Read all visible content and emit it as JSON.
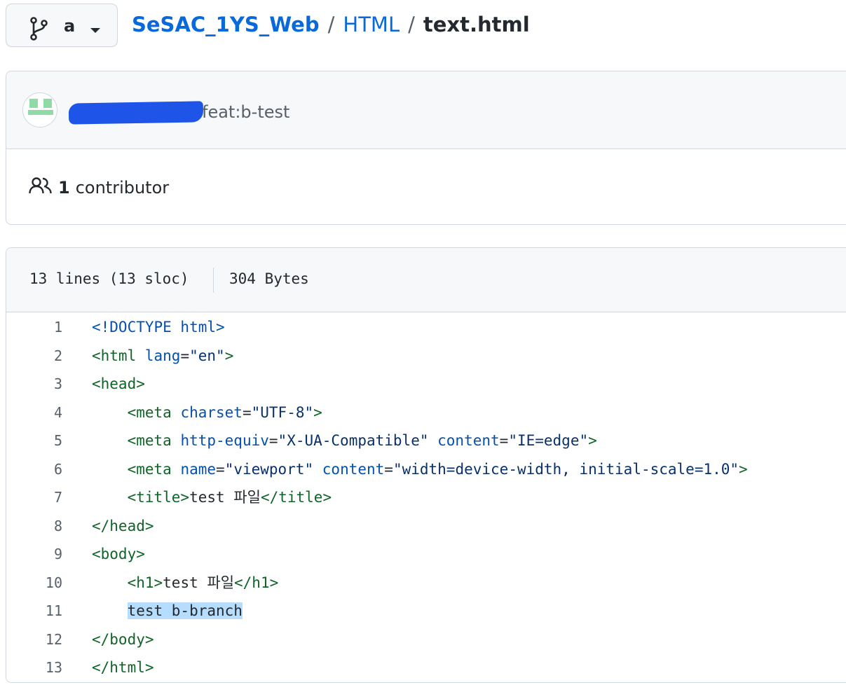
{
  "branch": {
    "name": "a"
  },
  "breadcrumb": {
    "repo": "SeSAC_1YS_Web",
    "dir": "HTML",
    "separator": "/",
    "file": "text.html"
  },
  "commit": {
    "message": "feat:b-test"
  },
  "contributors": {
    "count": "1",
    "label": "contributor"
  },
  "file_info": {
    "lines": "13 lines (13 sloc)",
    "size": "304 Bytes"
  },
  "code_lines": [
    {
      "num": "1",
      "indent": "",
      "tokens": [
        [
          "doc",
          "<!DOCTYPE html>"
        ]
      ]
    },
    {
      "num": "2",
      "indent": "",
      "tokens": [
        [
          "tag",
          "<html"
        ],
        [
          "text",
          " "
        ],
        [
          "attr",
          "lang"
        ],
        [
          "text",
          "="
        ],
        [
          "str",
          "\"en\""
        ],
        [
          "tag",
          ">"
        ]
      ]
    },
    {
      "num": "3",
      "indent": "",
      "tokens": [
        [
          "tag",
          "<head>"
        ]
      ]
    },
    {
      "num": "4",
      "indent": "    ",
      "tokens": [
        [
          "tag",
          "<meta"
        ],
        [
          "text",
          " "
        ],
        [
          "attr",
          "charset"
        ],
        [
          "text",
          "="
        ],
        [
          "str",
          "\"UTF-8\""
        ],
        [
          "tag",
          ">"
        ]
      ]
    },
    {
      "num": "5",
      "indent": "    ",
      "tokens": [
        [
          "tag",
          "<meta"
        ],
        [
          "text",
          " "
        ],
        [
          "attr",
          "http-equiv"
        ],
        [
          "text",
          "="
        ],
        [
          "str",
          "\"X-UA-Compatible\""
        ],
        [
          "text",
          " "
        ],
        [
          "attr",
          "content"
        ],
        [
          "text",
          "="
        ],
        [
          "str",
          "\"IE=edge\""
        ],
        [
          "tag",
          ">"
        ]
      ]
    },
    {
      "num": "6",
      "indent": "    ",
      "tokens": [
        [
          "tag",
          "<meta"
        ],
        [
          "text",
          " "
        ],
        [
          "attr",
          "name"
        ],
        [
          "text",
          "="
        ],
        [
          "str",
          "\"viewport\""
        ],
        [
          "text",
          " "
        ],
        [
          "attr",
          "content"
        ],
        [
          "text",
          "="
        ],
        [
          "str",
          "\"width=device-width, initial-scale=1.0\""
        ],
        [
          "tag",
          ">"
        ]
      ]
    },
    {
      "num": "7",
      "indent": "    ",
      "tokens": [
        [
          "tag",
          "<title>"
        ],
        [
          "text",
          "test 파일"
        ],
        [
          "tag",
          "</title>"
        ]
      ]
    },
    {
      "num": "8",
      "indent": "",
      "tokens": [
        [
          "tag",
          "</head>"
        ]
      ]
    },
    {
      "num": "9",
      "indent": "",
      "tokens": [
        [
          "tag",
          "<body>"
        ]
      ]
    },
    {
      "num": "10",
      "indent": "    ",
      "tokens": [
        [
          "tag",
          "<h1>"
        ],
        [
          "text",
          "test 파일"
        ],
        [
          "tag",
          "</h1>"
        ]
      ]
    },
    {
      "num": "11",
      "indent": "    ",
      "tokens": [
        [
          "hl",
          "test b-branch"
        ]
      ]
    },
    {
      "num": "12",
      "indent": "",
      "tokens": [
        [
          "tag",
          "</body>"
        ]
      ]
    },
    {
      "num": "13",
      "indent": "",
      "tokens": [
        [
          "tag",
          "</html>"
        ]
      ]
    }
  ],
  "colors": {
    "link": "#0969da",
    "tag": "#116329",
    "attr": "#0550ae",
    "string": "#0a3069",
    "highlight": "#b6dcfe",
    "redaction": "#1e54e8",
    "avatar": "#8fdba6"
  },
  "icons": {
    "branch": "git-branch-icon",
    "caret": "caret-down-icon",
    "people": "people-icon",
    "avatar": "identicon-avatar"
  }
}
